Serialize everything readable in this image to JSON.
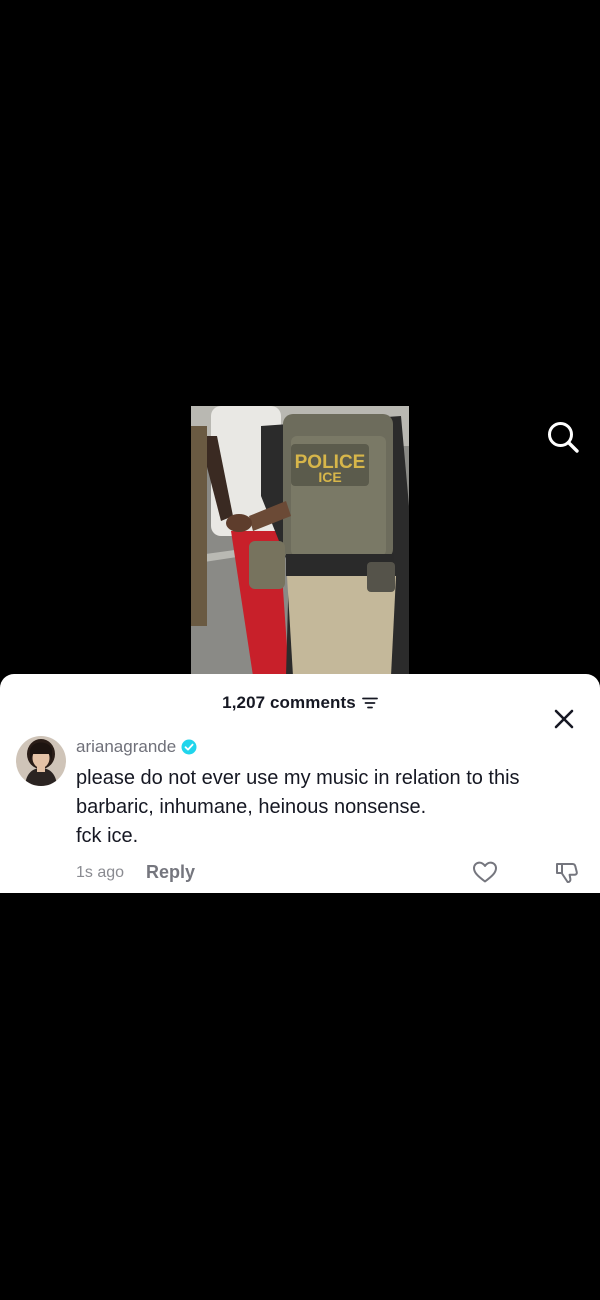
{
  "video": {
    "vest_text_line1": "POLICE",
    "vest_text_line2": "ICE"
  },
  "top_controls": {
    "search_icon": "search-icon"
  },
  "comments_panel": {
    "count_label": "1,207 comments",
    "filter_icon": "filter-icon",
    "close_icon": "close-icon"
  },
  "comment": {
    "username": "arianagrande",
    "verified": true,
    "verified_color": "#20d5ec",
    "text_lines": [
      "please do not ever use my music in relation to this",
      "barbaric, inhumane, heinous nonsense.",
      "fck ice."
    ],
    "timestamp": "1s ago",
    "reply_label": "Reply",
    "like_icon": "heart-outline-icon",
    "dislike_icon": "thumbs-down-icon"
  },
  "colors": {
    "background": "#000000",
    "sheet": "#ffffff",
    "primary_text": "#161823",
    "secondary_text": "#75767e"
  }
}
